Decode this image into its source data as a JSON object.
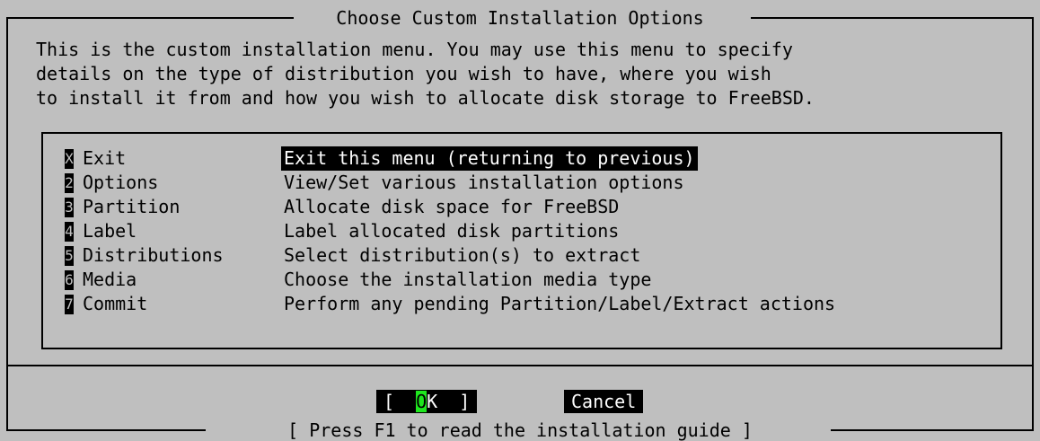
{
  "dialog": {
    "title": "Choose Custom Installation Options",
    "description": [
      "This is the custom installation menu. You may use this menu to specify",
      "details on the type of distribution you wish to have, where you wish",
      "to install it from and how you wish to allocate disk storage to FreeBSD."
    ],
    "menu": [
      {
        "key": "X",
        "name": "Exit",
        "desc": "Exit this menu (returning to previous)"
      },
      {
        "key": "2",
        "name": "Options",
        "desc": "View/Set various installation options"
      },
      {
        "key": "3",
        "name": "Partition",
        "desc": "Allocate disk space for FreeBSD"
      },
      {
        "key": "4",
        "name": "Label",
        "desc": "Label allocated disk partitions"
      },
      {
        "key": "5",
        "name": "Distributions",
        "desc": "Select distribution(s) to extract"
      },
      {
        "key": "6",
        "name": "Media",
        "desc": "Choose the installation media type"
      },
      {
        "key": "7",
        "name": "Commit",
        "desc": "Perform any pending Partition/Label/Extract actions"
      }
    ],
    "selected_index": 0,
    "buttons": {
      "ok_prefix": "[  ",
      "ok_accel": "O",
      "ok_rest": "K  ]",
      "cancel": "Cancel"
    },
    "footer": "[ Press F1 to read the installation guide ]"
  },
  "colors": {
    "background": "#bfbfbf",
    "text": "#000000",
    "highlight_bg": "#000000",
    "highlight_fg": "#ffffff",
    "accel": "#1ee81e"
  }
}
